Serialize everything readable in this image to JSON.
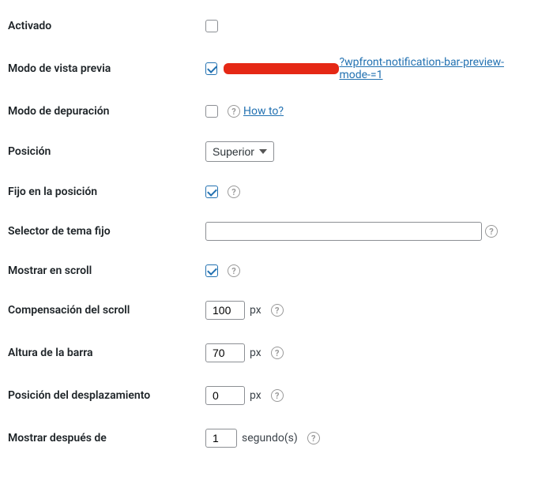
{
  "rows": {
    "activado": {
      "label": "Activado",
      "checked": false
    },
    "preview": {
      "label": "Modo de vista previa",
      "checked": true,
      "link_text": "?wpfront-notification-bar-preview-mode-=1"
    },
    "debug": {
      "label": "Modo de depuración",
      "checked": false,
      "help_link": "How to?"
    },
    "position": {
      "label": "Posición",
      "selected": "Superior"
    },
    "fixed": {
      "label": "Fijo en la posición",
      "checked": true
    },
    "theme_selector": {
      "label": "Selector de tema fijo",
      "value": ""
    },
    "scroll": {
      "label": "Mostrar en scroll",
      "checked": true
    },
    "scroll_offset": {
      "label": "Compensación del scroll",
      "value": "100",
      "unit": "px"
    },
    "bar_height": {
      "label": "Altura de la barra",
      "value": "70",
      "unit": "px"
    },
    "offset_position": {
      "label": "Posición del desplazamiento",
      "value": "0",
      "unit": "px"
    },
    "show_after": {
      "label": "Mostrar después de",
      "value": "1",
      "unit": "segundo(s)"
    }
  }
}
